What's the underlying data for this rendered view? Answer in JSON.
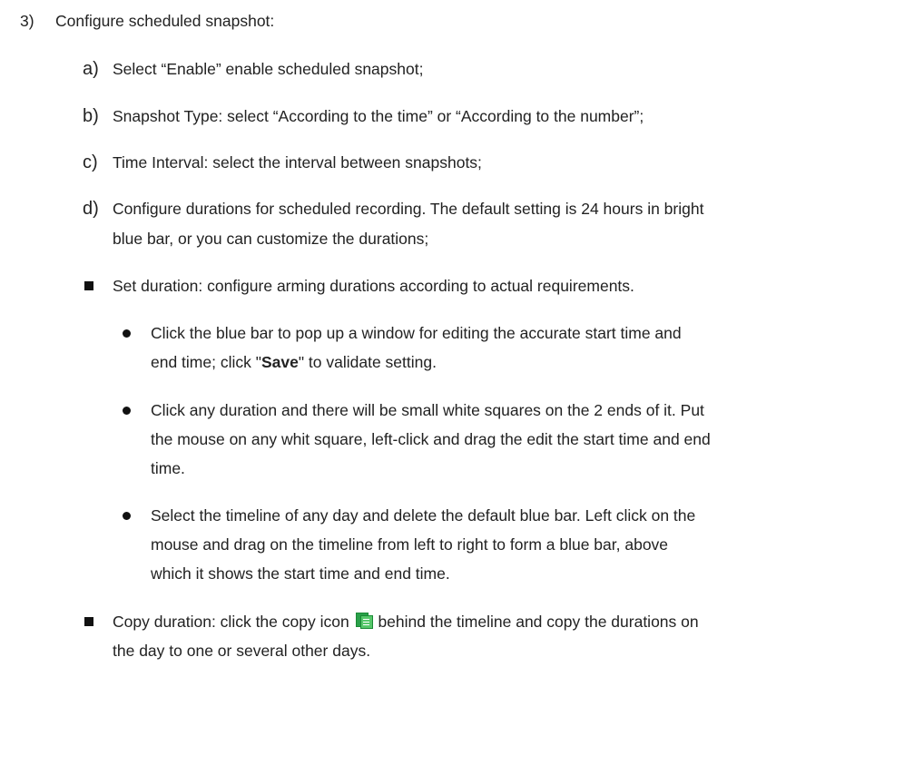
{
  "step3": {
    "marker": "3)",
    "text": "Configure scheduled snapshot:"
  },
  "substeps": [
    {
      "marker": "a)",
      "lines": [
        "Select “Enable” enable scheduled snapshot;"
      ]
    },
    {
      "marker": "b)",
      "lines": [
        "Snapshot Type: select “According to the time” or “According to the number”;"
      ]
    },
    {
      "marker": "c)",
      "lines": [
        "Time Interval: select the interval between snapshots;"
      ]
    },
    {
      "marker": "d)",
      "lines": [
        "Configure durations for scheduled recording. The default setting is 24 hours in bright",
        "blue bar, or you can customize the durations;"
      ]
    }
  ],
  "set_duration": {
    "text": "Set duration: configure arming durations according to actual requirements.",
    "bullets": [
      {
        "line1": "Click the blue bar to pop up a window for editing the accurate start time and",
        "line2_before": "end time; click \"",
        "line2_bold": "Save",
        "line2_after": "\" to validate setting."
      },
      {
        "lines": [
          "Click any duration and there will be small white squares on the 2 ends of it. Put",
          "the mouse on any whit square, left-click and drag the edit the start time and end",
          "time."
        ]
      },
      {
        "lines": [
          "Select the timeline of any day and delete the default blue bar. Left click on the",
          "mouse and drag on the timeline from left to right to form a blue bar, above",
          "which it shows the start time and end time."
        ]
      }
    ]
  },
  "copy_duration": {
    "before_icon": "Copy duration: click the copy icon",
    "after_icon": "behind the timeline and copy the durations on",
    "line2": "the day to one or several other days.",
    "icon": "copy-icon",
    "icon_color": "#2aa04a"
  }
}
